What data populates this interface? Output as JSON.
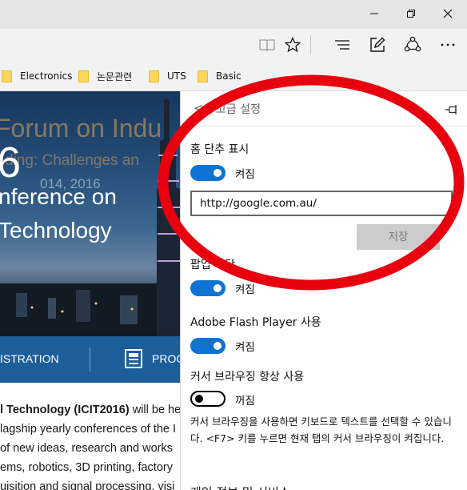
{
  "favorites": [
    {
      "label": "Electronics"
    },
    {
      "label": "논문관련"
    },
    {
      "label": "UTS"
    },
    {
      "label": "Basic"
    }
  ],
  "webpage": {
    "banner_lines": [
      "Forum on Indu",
      "ding: Challenges an",
      "6",
      "014, 2016",
      "nference on",
      "Technology"
    ],
    "nav_items": [
      "ISTRATION",
      "PROG"
    ],
    "body_lines": [
      {
        "bold": "l Technology (ICIT2016)",
        "rest": " will be he"
      },
      {
        "bold": "",
        "rest": "lagship yearly conferences of the I"
      },
      {
        "bold": "",
        "rest": "of new ideas, research and works"
      },
      {
        "bold": "",
        "rest": "ems, robotics, 3D printing, factory"
      },
      {
        "bold": "",
        "rest": "uisition and signal processing, visi"
      }
    ]
  },
  "settings": {
    "back_label": "<",
    "title": "고급 설정",
    "home_button": {
      "label": "홈 단추 표시",
      "state": "켜짐",
      "url": "http://google.com.au/",
      "save_label": "저장"
    },
    "popup_block": {
      "label": "팝업 차단",
      "state": "켜짐"
    },
    "flash": {
      "label": "Adobe Flash Player 사용",
      "state": "켜짐"
    },
    "caret_browsing": {
      "label": "커서 브라우징 항상 사용",
      "state": "꺼짐",
      "description": "커서 브라우징을 사용하면 키보드로 텍스트를 선택할 수 있습니다. <F7> 키를 누르면 현재 탭의 커서 브라우징이 켜집니다."
    },
    "next_section_partial": "개인 정보 및 서비스"
  },
  "colors": {
    "toggle_on": "#0f73d4",
    "annotation": "#e8000f",
    "save_disabled": "#cccccc"
  }
}
